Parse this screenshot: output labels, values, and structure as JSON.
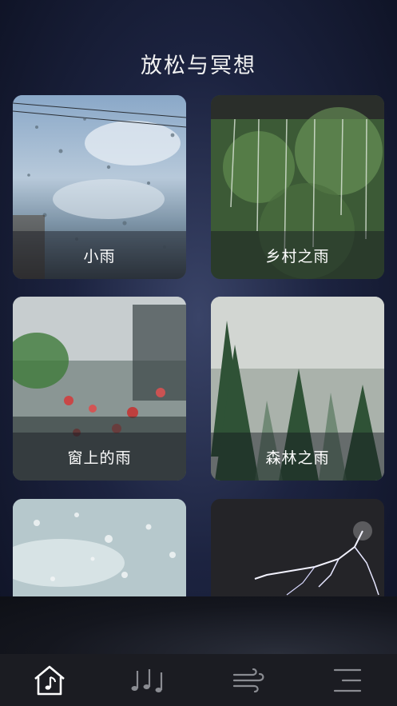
{
  "header": {
    "title": "放松与冥想"
  },
  "cards": [
    {
      "label": "小雨"
    },
    {
      "label": "乡村之雨"
    },
    {
      "label": "窗上的雨"
    },
    {
      "label": "森林之雨"
    },
    {
      "label": ""
    },
    {
      "label": ""
    }
  ],
  "tabbar": {
    "items": [
      {
        "icon": "home-music-icon",
        "active": true
      },
      {
        "icon": "music-notes-icon",
        "active": false
      },
      {
        "icon": "wind-icon",
        "active": false
      },
      {
        "icon": "menu-icon",
        "active": false
      }
    ]
  }
}
